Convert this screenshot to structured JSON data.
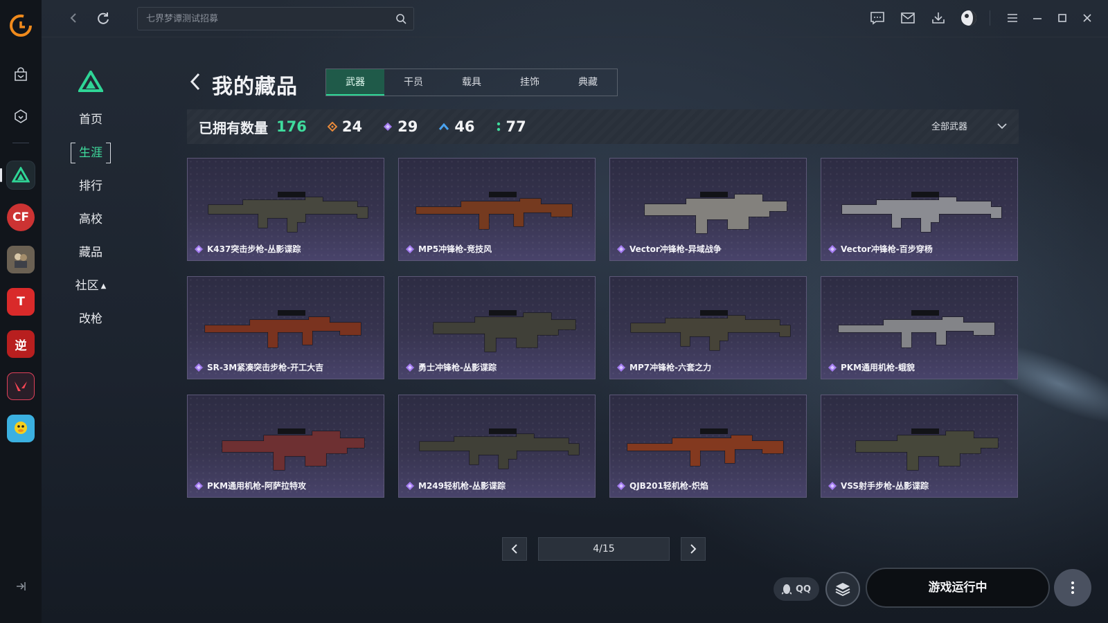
{
  "topbar": {
    "search_placeholder": "七界梦谭测试招募"
  },
  "sidebar": {
    "items": [
      {
        "label": "首页"
      },
      {
        "label": "生涯"
      },
      {
        "label": "排行"
      },
      {
        "label": "高校"
      },
      {
        "label": "藏品"
      },
      {
        "label": "社区"
      },
      {
        "label": "改枪"
      }
    ],
    "active_index": 1,
    "expand_icon": "caret-up-icon"
  },
  "page": {
    "title": "我的藏品",
    "tabs": [
      {
        "label": "武器"
      },
      {
        "label": "干员"
      },
      {
        "label": "载具"
      },
      {
        "label": "挂饰"
      },
      {
        "label": "典藏"
      }
    ],
    "active_tab": 0
  },
  "stats": {
    "owned_label": "已拥有数量",
    "owned_total": "176",
    "tiers": [
      {
        "icon": "orange-diamond-icon",
        "color": "#e88a3a",
        "count": "24"
      },
      {
        "icon": "purple-diamond-icon",
        "color": "#a37bf0",
        "count": "29"
      },
      {
        "icon": "blue-chevron-icon",
        "color": "#4aa3f0",
        "count": "46"
      },
      {
        "icon": "green-dots-icon",
        "color": "#3fdc9d",
        "count": "77"
      }
    ],
    "filter_label": "全部武器"
  },
  "items": [
    {
      "name": "K437突击步枪-丛影谍踪",
      "accent": "#6b6a55"
    },
    {
      "name": "MP5冲锋枪-竞技风",
      "accent": "#c0521e"
    },
    {
      "name": "Vector冲锋枪-异域战争",
      "accent": "#d8d4c8"
    },
    {
      "name": "Vector冲锋枪-百步穿杨",
      "accent": "#e8e8ee"
    },
    {
      "name": "SR-3M紧凑突击步枪-开工大吉",
      "accent": "#c8461e"
    },
    {
      "name": "勇士冲锋枪-丛影谍踪",
      "accent": "#5e5d4a"
    },
    {
      "name": "MP7冲锋枪-六套之力",
      "accent": "#6a624a"
    },
    {
      "name": "PKM通用机枪-蛾貌",
      "accent": "#d8d8dc"
    },
    {
      "name": "PKM通用机枪-阿萨拉特攻",
      "accent": "#b24040"
    },
    {
      "name": "M249轻机枪-丛影谍踪",
      "accent": "#5f5d48"
    },
    {
      "name": "QJB201轻机枪-炽焰",
      "accent": "#d8501e"
    },
    {
      "name": "VSS射手步枪-丛影谍踪",
      "accent": "#6a6a4e"
    }
  ],
  "pager": {
    "page_text": "4/15"
  },
  "bottom": {
    "qq_label": "QQ",
    "launch_label": "游戏运行中"
  },
  "colors": {
    "accent_green": "#3fdc9d",
    "rarity_purple": "#a37bf0"
  }
}
